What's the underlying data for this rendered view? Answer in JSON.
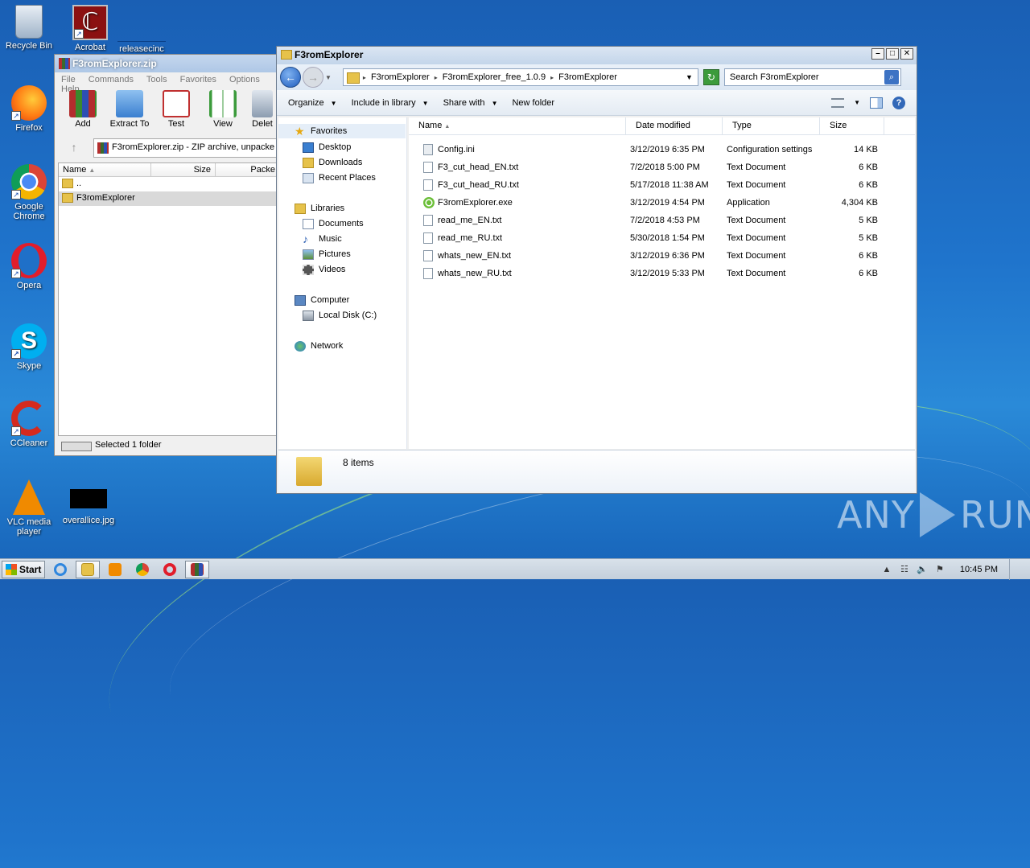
{
  "desktop": {
    "icons": [
      {
        "label": "Recycle Bin",
        "icon": "recycle-bin-icon"
      },
      {
        "label": "Acrobat",
        "icon": "acrobat-icon"
      },
      {
        "label": "releasecinc",
        "icon": "file-icon"
      },
      {
        "label": "Firefox",
        "icon": "firefox-icon"
      },
      {
        "label": "Google Chrome",
        "icon": "chrome-icon"
      },
      {
        "label": "Opera",
        "icon": "opera-icon"
      },
      {
        "label": "Skype",
        "icon": "skype-icon"
      },
      {
        "label": "CCleaner",
        "icon": "ccleaner-icon"
      },
      {
        "label": "VLC media player",
        "icon": "vlc-icon"
      },
      {
        "label": "overallice.jpg",
        "icon": "image-icon"
      }
    ],
    "watermark": "ANY RUN"
  },
  "winrar": {
    "title": "F3romExplorer.zip",
    "menu": [
      "File",
      "Commands",
      "Tools",
      "Favorites",
      "Options",
      "Help"
    ],
    "toolbar": [
      "Add",
      "Extract To",
      "Test",
      "View",
      "Delete"
    ],
    "toolbar_visible": [
      "Add",
      "Extract To",
      "Test",
      "View",
      "Delet"
    ],
    "path": "F3romExplorer.zip - ZIP archive, unpacke",
    "columns": [
      "Name",
      "Size",
      "Packe"
    ],
    "rows": [
      "..",
      "F3romExplorer"
    ],
    "status": "Selected 1 folder"
  },
  "explorer": {
    "title": "F3romExplorer",
    "breadcrumb": [
      "F3romExplorer",
      "F3romExplorer_free_1.0.9",
      "F3romExplorer"
    ],
    "search_placeholder": "Search F3romExplorer",
    "commands": [
      "Organize",
      "Include in library",
      "Share with",
      "New folder"
    ],
    "nav": {
      "favorites": "Favorites",
      "desktop": "Desktop",
      "downloads": "Downloads",
      "recent": "Recent Places",
      "libraries": "Libraries",
      "documents": "Documents",
      "music": "Music",
      "pictures": "Pictures",
      "videos": "Videos",
      "computer": "Computer",
      "localdisk": "Local Disk (C:)",
      "network": "Network"
    },
    "columns": {
      "name": "Name",
      "date": "Date modified",
      "type": "Type",
      "size": "Size"
    },
    "files": [
      {
        "name": "Config.ini",
        "date": "3/12/2019 6:35 PM",
        "type": "Configuration settings",
        "size": "14 KB",
        "icon": "ini"
      },
      {
        "name": "F3_cut_head_EN.txt",
        "date": "7/2/2018 5:00 PM",
        "type": "Text Document",
        "size": "6 KB",
        "icon": "txt"
      },
      {
        "name": "F3_cut_head_RU.txt",
        "date": "5/17/2018 11:38 AM",
        "type": "Text Document",
        "size": "6 KB",
        "icon": "txt"
      },
      {
        "name": "F3romExplorer.exe",
        "date": "3/12/2019 4:54 PM",
        "type": "Application",
        "size": "4,304 KB",
        "icon": "exe"
      },
      {
        "name": "read_me_EN.txt",
        "date": "7/2/2018 4:53 PM",
        "type": "Text Document",
        "size": "5 KB",
        "icon": "txt"
      },
      {
        "name": "read_me_RU.txt",
        "date": "5/30/2018 1:54 PM",
        "type": "Text Document",
        "size": "5 KB",
        "icon": "txt"
      },
      {
        "name": "whats_new_EN.txt",
        "date": "3/12/2019 6:36 PM",
        "type": "Text Document",
        "size": "6 KB",
        "icon": "txt"
      },
      {
        "name": "whats_new_RU.txt",
        "date": "3/12/2019 5:33 PM",
        "type": "Text Document",
        "size": "6 KB",
        "icon": "txt"
      }
    ],
    "item_count": "8 items"
  },
  "taskbar": {
    "start": "Start",
    "clock": "10:45 PM"
  }
}
